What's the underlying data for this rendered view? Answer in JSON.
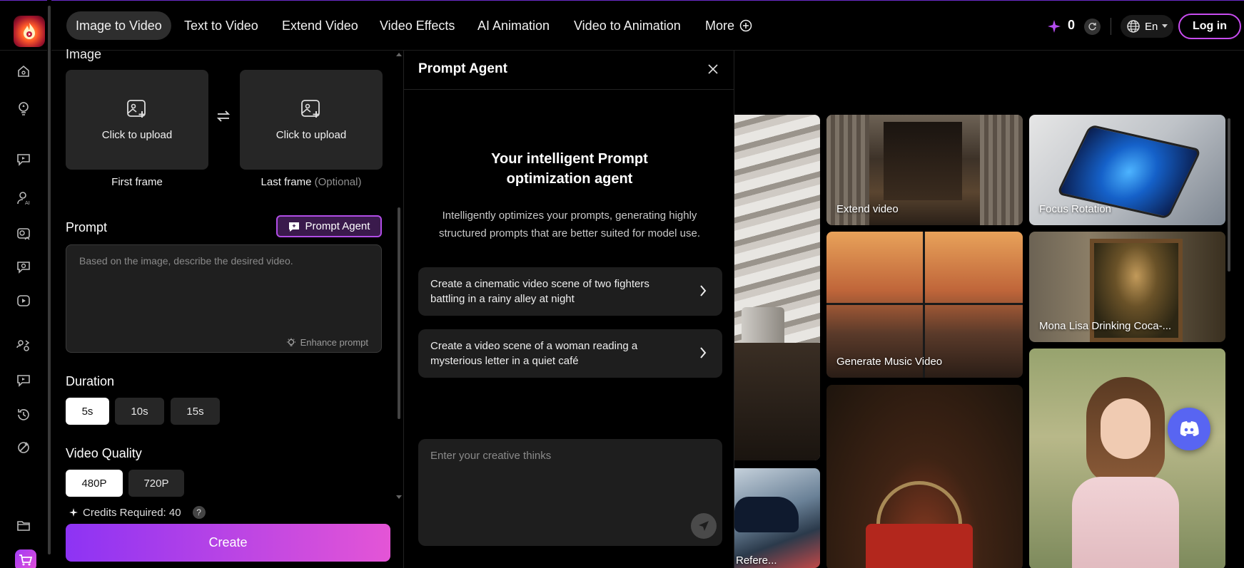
{
  "topnav": {
    "tabs": [
      {
        "label": "Image to Video",
        "active": true
      },
      {
        "label": "Text to Video"
      },
      {
        "label": "Extend Video"
      },
      {
        "label": "Video Effects"
      },
      {
        "label": "AI Animation"
      },
      {
        "label": "Video to Animation"
      },
      {
        "label": "More"
      }
    ],
    "credits": "0",
    "language": "En",
    "login_label": "Log in"
  },
  "sidebar": {
    "icons": [
      "home-icon",
      "lightbulb-icon",
      "chat-video-icon",
      "ai-avatar-icon",
      "image-video-icon",
      "video-chat-icon",
      "play-box-icon",
      "swap-people-icon",
      "replay-chat-icon",
      "history-icon",
      "magic-icon",
      "folder-icon",
      "cart-icon"
    ]
  },
  "left_panel": {
    "image_section_label": "Image",
    "upload_label": "Click to upload",
    "first_frame_label": "First frame",
    "last_frame_label": "Last frame",
    "last_frame_optional": "(Optional)",
    "prompt_label": "Prompt",
    "prompt_agent_button": "Prompt Agent",
    "prompt_placeholder": "Based on the image, describe the desired video.",
    "enhance_prompt": "Enhance prompt",
    "duration_label": "Duration",
    "durations": [
      "5s",
      "10s",
      "15s"
    ],
    "selected_duration": "5s",
    "quality_label": "Video Quality",
    "qualities": [
      "480P",
      "720P"
    ],
    "selected_quality": "480P",
    "credits_required": "Credits Required: 40",
    "help": "?",
    "create_button": "Create"
  },
  "agent_panel": {
    "title": "Prompt Agent",
    "headline_line1": "Your intelligent Prompt",
    "headline_line2": "optimization agent",
    "description": "Intelligently optimizes your prompts, generating highly structured prompts that are better suited for model use.",
    "suggestions": [
      "Create a cinematic video scene of two fighters battling in a rainy alley at night",
      "Create a video scene of a woman reading a mysterious letter in a quiet café"
    ],
    "input_placeholder": "Enter your creative thinks"
  },
  "gallery": {
    "cards": [
      {
        "caption": ""
      },
      {
        "caption": "Refere..."
      },
      {
        "caption": "Extend video"
      },
      {
        "caption": "Generate Music Video"
      },
      {
        "caption": ""
      },
      {
        "caption": "Focus Rotation"
      },
      {
        "caption": "Mona Lisa Drinking Coca-..."
      },
      {
        "caption": ""
      }
    ]
  },
  "colors": {
    "accent_purple": "#8d33f4",
    "accent_pink": "#e455d6",
    "login_border": "#c84cf0",
    "discord": "#5865f2"
  }
}
